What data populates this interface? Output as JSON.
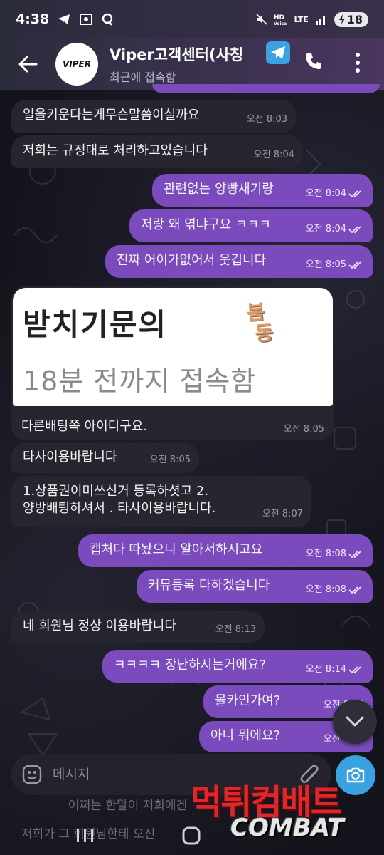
{
  "status_bar": {
    "time": "4:38",
    "net_label": "LTE",
    "battery": "18"
  },
  "header": {
    "title": "Viper고객센터(사칭",
    "subtitle": "최근에 접속함",
    "avatar_text": "VIPER"
  },
  "messages": [
    {
      "dir": "in",
      "text": "일을키운다는게무슨말씀이실까요",
      "time": "오전 8:03"
    },
    {
      "dir": "in",
      "text": "저희는 규정대로 처리하고있습니다",
      "time": "오전 8:04"
    },
    {
      "dir": "out",
      "text": "관련없는 양빵새기랑",
      "time": "오전 8:04"
    },
    {
      "dir": "out",
      "text": "저랑 왜 엮냐구요 ㅋㅋㅋ",
      "time": "오전 8:04"
    },
    {
      "dir": "out",
      "text": "진짜 어이가없어서 웃깁니다",
      "time": "오전 8:05"
    },
    {
      "dir": "in",
      "text": "타사이용바랍니다",
      "time": "오전 8:05"
    },
    {
      "dir": "in",
      "text": "1.상품권이미쓰신거 등록하셧고 2.",
      "text2": "양방배팅하셔서 . 타사이용바랍니다.",
      "time": "오전 8:07"
    },
    {
      "dir": "out",
      "text": "캡처다 따놨으니 알아서하시고요",
      "time": "오전 8:08"
    },
    {
      "dir": "out",
      "text": "커뮤등록 다하겠습니다",
      "time": "오전 8:08"
    },
    {
      "dir": "in",
      "text": "네 회원님 정상 이용바랍니다",
      "time": "오전 8:13"
    },
    {
      "dir": "out",
      "text": "ㅋㅋㅋㅋ 장난하시는거에요?",
      "time": "오전 8:14"
    },
    {
      "dir": "out",
      "text": "몰카인가여?",
      "time": "오전 8:14"
    },
    {
      "dir": "out",
      "text": "아니 뭐에요?",
      "time": "오전 8:14"
    }
  ],
  "image_message": {
    "line1": "받치기문의",
    "line2": "18분 전까지 접속함",
    "stamp": "봄동",
    "caption": "다른배팅쪽 아이디구요.",
    "time": "오전 8:05"
  },
  "input": {
    "placeholder": "메시지"
  },
  "ghost_lines": [
    "어쩌는 한말이 저희에겐",
    "저희가 그      회원님한테 오전"
  ],
  "watermark": {
    "top": "먹튀컴배트",
    "bottom": "COMBAT"
  },
  "colors": {
    "incoming": "#27262f",
    "outgoing": "#7b4bbd",
    "accent": "#3aa2e0"
  }
}
